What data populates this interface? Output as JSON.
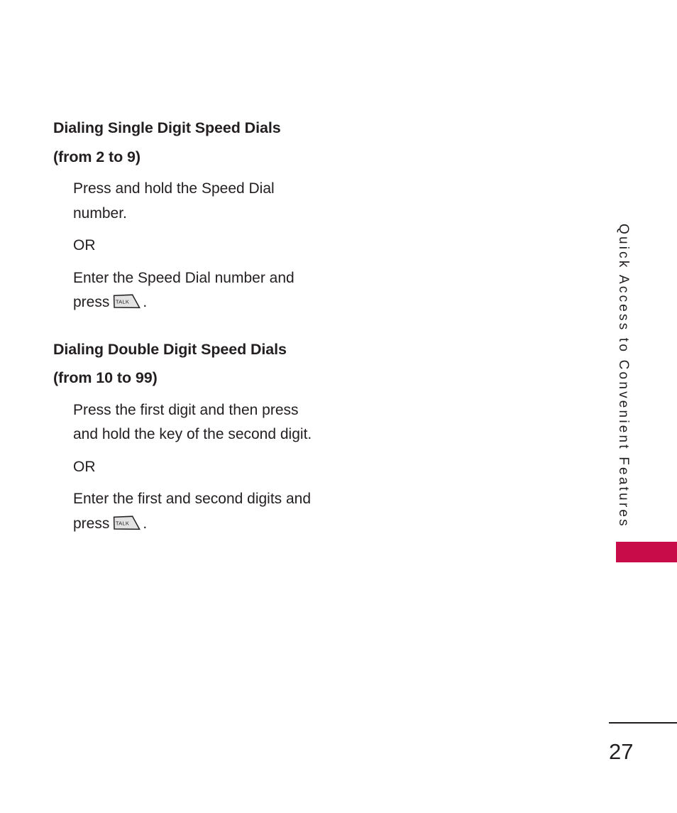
{
  "page": {
    "number": "27",
    "side_tab_text": "Quick Access to Convenient Features",
    "accent_color": "#c80b49",
    "text_color": "#231f20"
  },
  "sections": [
    {
      "heading": "Dialing Single Digit Speed Dials (from 2 to 9)",
      "paragraphs": [
        {
          "text": "Press and hold the Speed Dial number."
        },
        {
          "text": "OR"
        },
        {
          "text_before": "Enter the Speed Dial number and press",
          "key_icon": "talk-key",
          "key_label": "TALK",
          "text_after": "."
        }
      ]
    },
    {
      "heading": "Dialing Double Digit Speed Dials (from 10 to 99)",
      "paragraphs": [
        {
          "text": "Press the first digit and then press and hold the key of the second digit."
        },
        {
          "text": "OR"
        },
        {
          "text_before": "Enter the first and second digits and press",
          "key_icon": "talk-key",
          "key_label": "TALK",
          "text_after": "."
        }
      ]
    }
  ]
}
